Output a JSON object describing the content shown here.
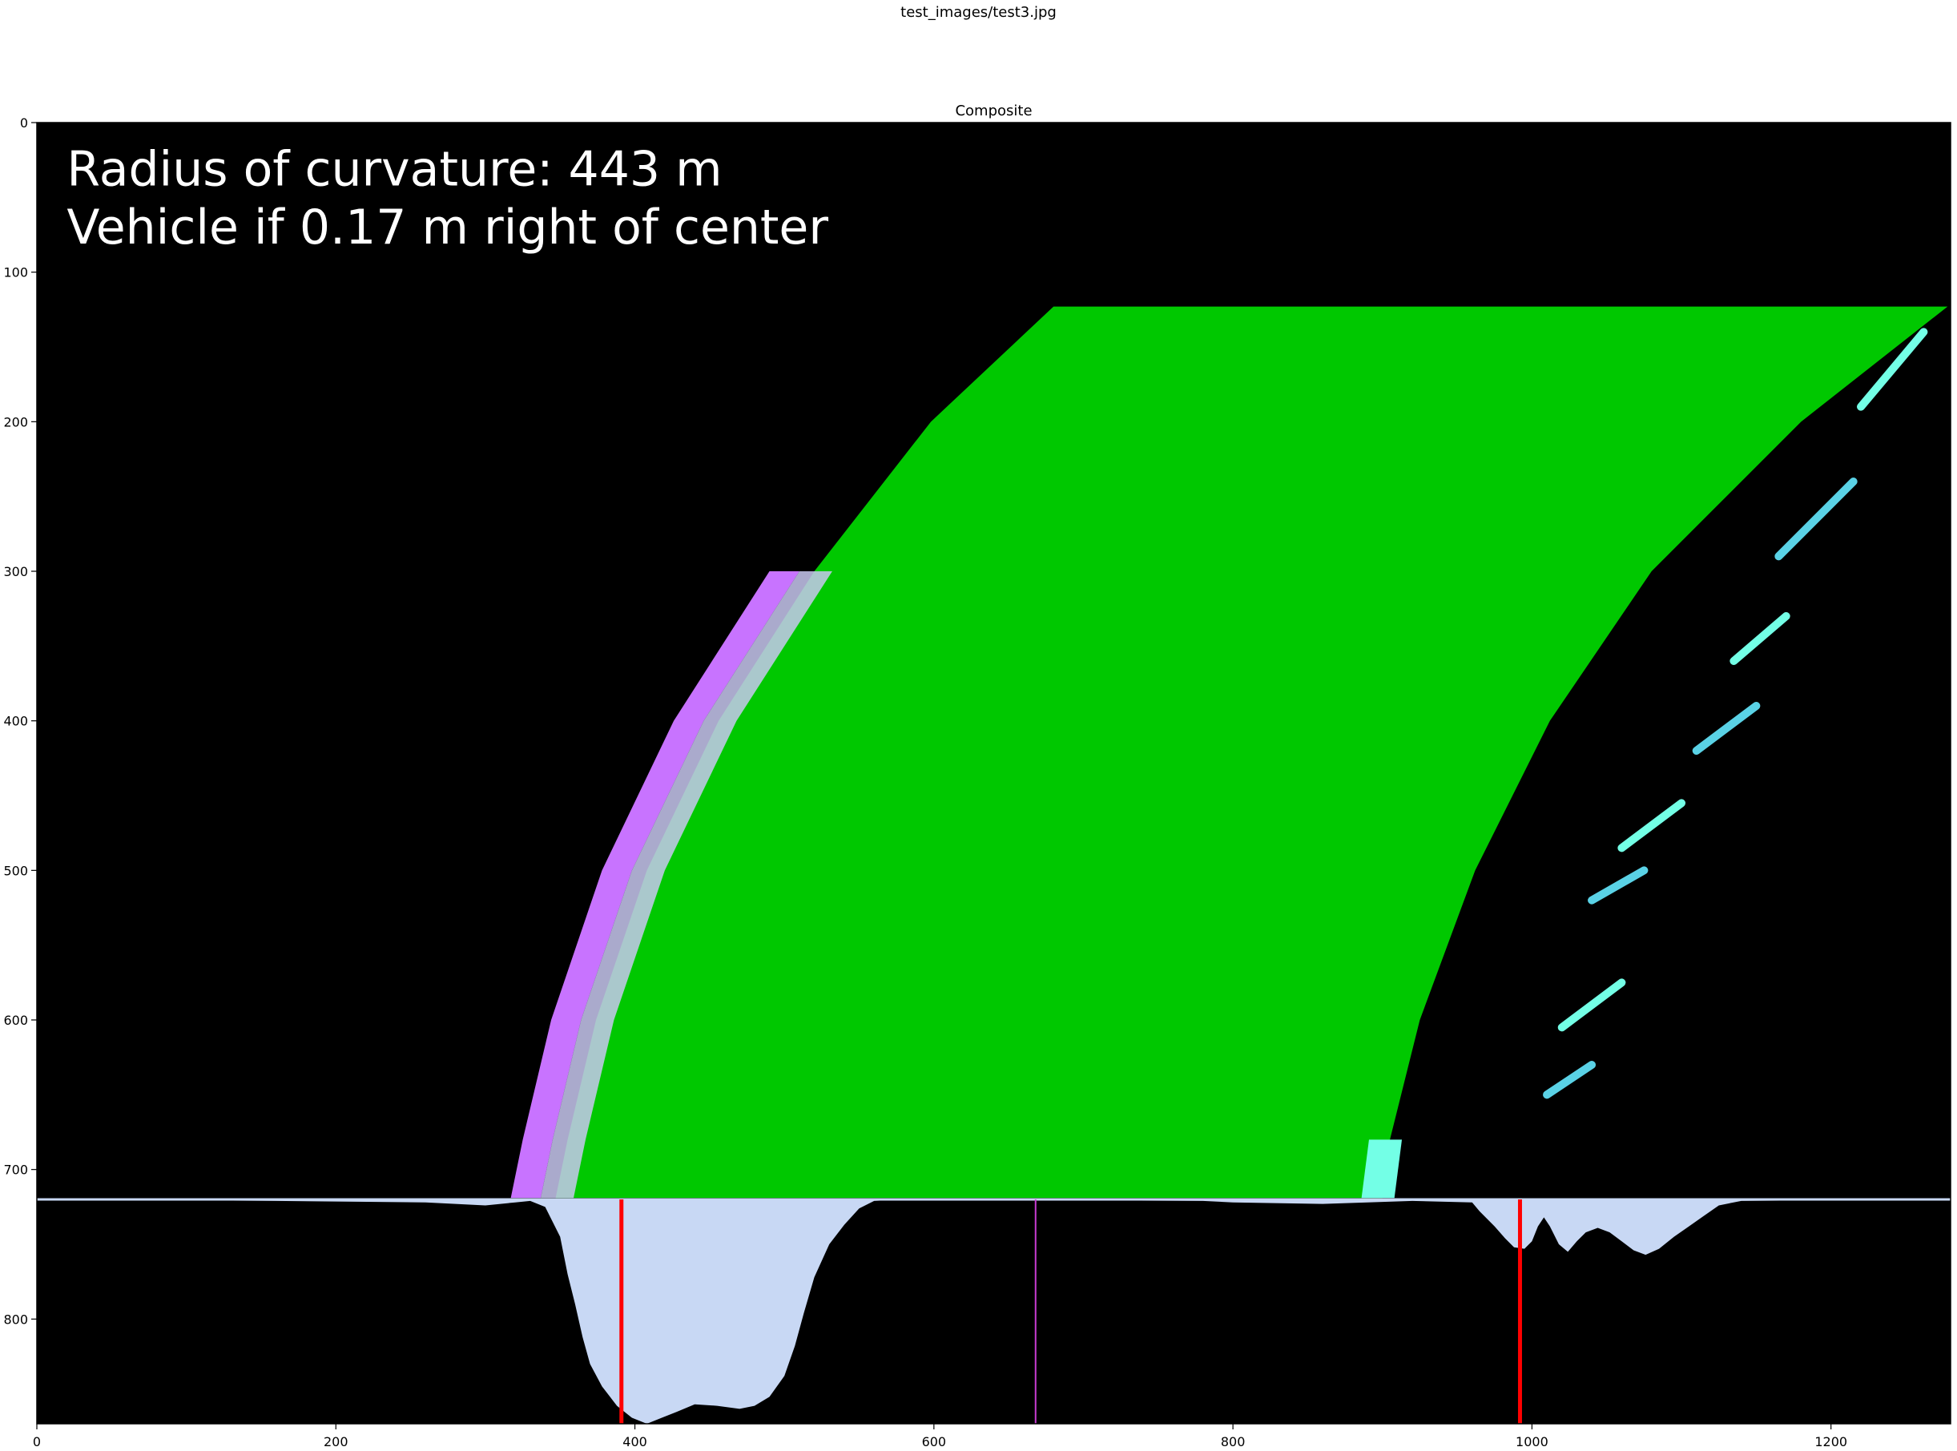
{
  "figure": {
    "suptitle": "test_images/test3.jpg"
  },
  "chart_data": {
    "type": "image",
    "title": "Composite",
    "xlim": [
      0,
      1280
    ],
    "ylim": [
      870,
      0
    ],
    "xticks": [
      0,
      200,
      400,
      600,
      800,
      1000,
      1200
    ],
    "yticks": [
      0,
      100,
      200,
      300,
      400,
      500,
      600,
      700,
      800
    ],
    "grid": false,
    "overlay_text": [
      "Radius of curvature: 443 m",
      "Vehicle if 0.17 m right of center"
    ],
    "lane_fill": {
      "color": "#00c800",
      "top_y": 123,
      "bottom_y": 719,
      "left_edge": [
        [
          680,
          123
        ],
        [
          598,
          200
        ],
        [
          520,
          300
        ],
        [
          456,
          400
        ],
        [
          408,
          500
        ],
        [
          374,
          600
        ],
        [
          355,
          680
        ],
        [
          347,
          719
        ]
      ],
      "right_edge": [
        [
          1278,
          123
        ],
        [
          1180,
          200
        ],
        [
          1080,
          300
        ],
        [
          1012,
          400
        ],
        [
          962,
          500
        ],
        [
          925,
          600
        ],
        [
          905,
          680
        ],
        [
          900,
          719
        ]
      ]
    },
    "left_lane_color": "#c873ff",
    "right_lane_color": "#73ffe6",
    "histogram": {
      "color": "#c8d8f4",
      "baseline_y": 720,
      "points": [
        [
          0,
          720
        ],
        [
          160,
          721
        ],
        [
          260,
          722
        ],
        [
          300,
          724
        ],
        [
          320,
          722
        ],
        [
          330,
          721
        ],
        [
          340,
          725
        ],
        [
          350,
          745
        ],
        [
          355,
          770
        ],
        [
          360,
          790
        ],
        [
          365,
          812
        ],
        [
          370,
          830
        ],
        [
          378,
          845
        ],
        [
          388,
          858
        ],
        [
          398,
          866
        ],
        [
          408,
          870
        ],
        [
          418,
          866
        ],
        [
          428,
          862
        ],
        [
          440,
          857
        ],
        [
          455,
          858
        ],
        [
          470,
          860
        ],
        [
          480,
          858
        ],
        [
          490,
          852
        ],
        [
          500,
          838
        ],
        [
          507,
          818
        ],
        [
          513,
          796
        ],
        [
          520,
          772
        ],
        [
          530,
          750
        ],
        [
          540,
          737
        ],
        [
          550,
          726
        ],
        [
          560,
          721
        ],
        [
          580,
          720
        ],
        [
          780,
          721
        ],
        [
          800,
          722
        ],
        [
          860,
          723
        ],
        [
          920,
          721
        ],
        [
          960,
          722
        ],
        [
          965,
          728
        ],
        [
          975,
          738
        ],
        [
          982,
          746
        ],
        [
          988,
          752
        ],
        [
          995,
          753
        ],
        [
          1000,
          748
        ],
        [
          1004,
          738
        ],
        [
          1008,
          732
        ],
        [
          1012,
          738
        ],
        [
          1018,
          750
        ],
        [
          1024,
          755
        ],
        [
          1030,
          748
        ],
        [
          1036,
          742
        ],
        [
          1044,
          739
        ],
        [
          1052,
          742
        ],
        [
          1060,
          748
        ],
        [
          1068,
          754
        ],
        [
          1076,
          757
        ],
        [
          1085,
          753
        ],
        [
          1095,
          745
        ],
        [
          1105,
          738
        ],
        [
          1115,
          731
        ],
        [
          1125,
          724
        ],
        [
          1140,
          721
        ],
        [
          1280,
          720
        ]
      ]
    },
    "left_peak_x": 391,
    "right_peak_x": 992,
    "center_x": 668,
    "peak_line_color": "#ff0000",
    "center_line_color": "#c83cd2"
  }
}
